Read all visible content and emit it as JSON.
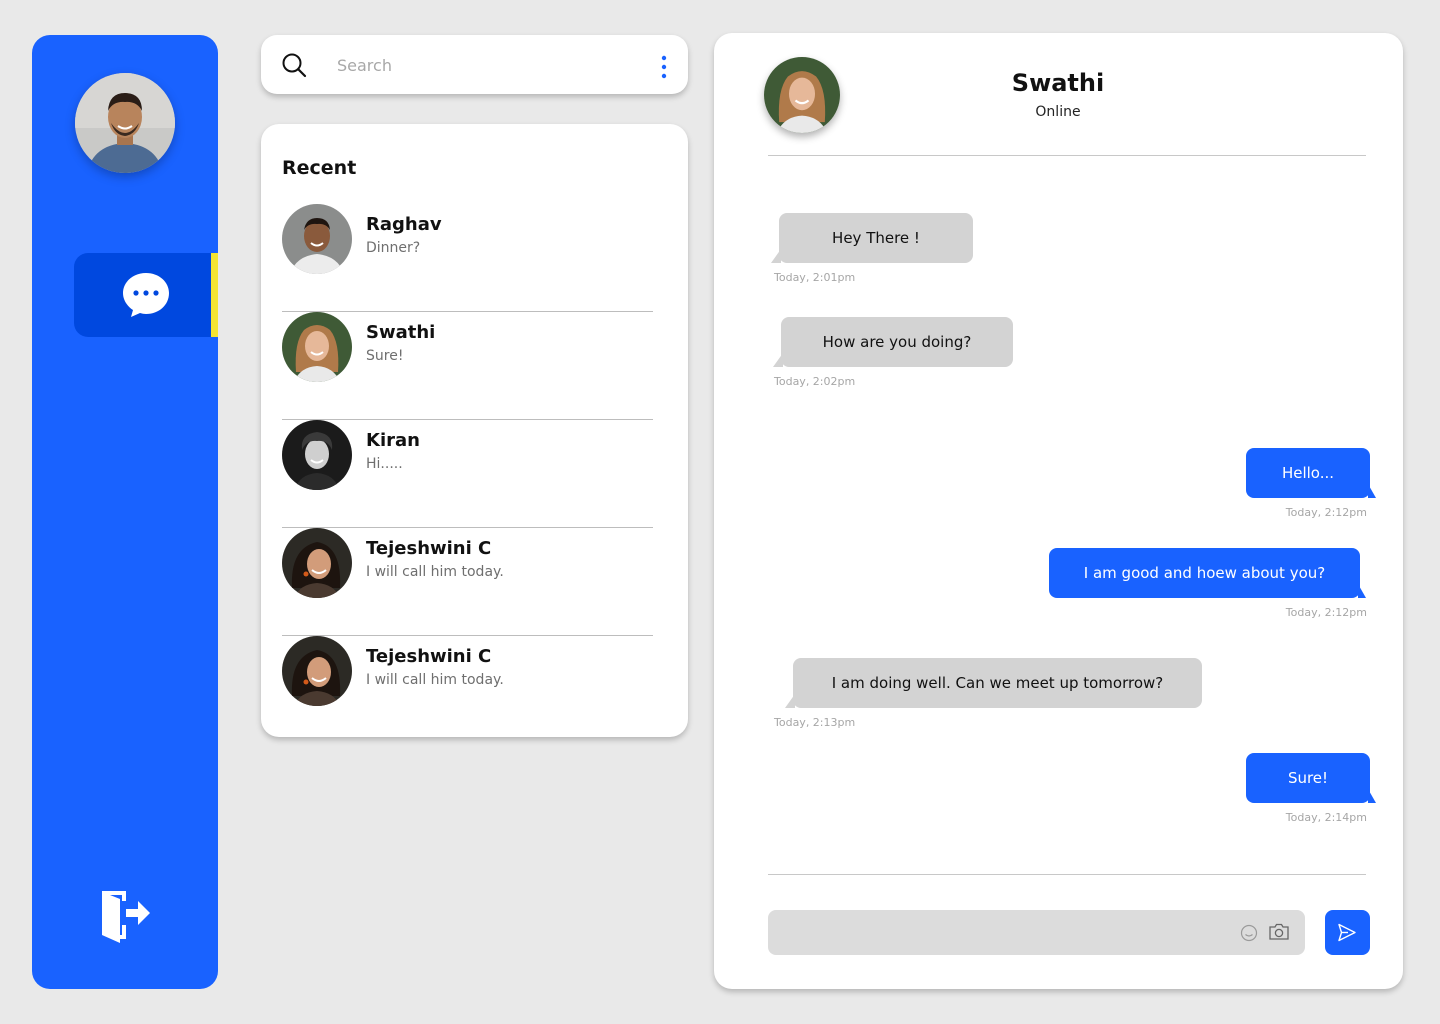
{
  "sidebar": {
    "user_avatar": "user-avatar",
    "nav": [
      {
        "name": "chat",
        "icon": "chat-bubble-icon",
        "active": true
      }
    ],
    "logout_icon": "logout-icon"
  },
  "search": {
    "placeholder": "Search",
    "menu_icon": "kebab-menu-icon"
  },
  "recent": {
    "title": "Recent",
    "contacts": [
      {
        "name": "Raghav",
        "last_message": "Dinner?"
      },
      {
        "name": "Swathi",
        "last_message": "Sure!"
      },
      {
        "name": "Kiran",
        "last_message": "Hi....."
      },
      {
        "name": "Tejeshwini C",
        "last_message": "I will call him today."
      },
      {
        "name": "Tejeshwini C",
        "last_message": "I will call him today."
      }
    ]
  },
  "chat": {
    "contact_name": "Swathi",
    "status": "Online",
    "messages": [
      {
        "direction": "in",
        "text": "Hey There !",
        "time": "Today, 2:01pm"
      },
      {
        "direction": "in",
        "text": "How are you doing?",
        "time": "Today, 2:02pm"
      },
      {
        "direction": "out",
        "text": "Hello...",
        "time": "Today, 2:12pm"
      },
      {
        "direction": "out",
        "text": "I am good  and hoew about you?",
        "time": "Today, 2:12pm"
      },
      {
        "direction": "in",
        "text": "I am doing well. Can we meet up tomorrow?",
        "time": "Today, 2:13pm"
      },
      {
        "direction": "out",
        "text": "Sure!",
        "time": "Today, 2:14pm"
      }
    ],
    "composer": {
      "placeholder": "",
      "emoji_icon": "emoji-icon",
      "camera_icon": "camera-icon"
    },
    "send_icon": "send-icon"
  },
  "colors": {
    "primary": "#1962ff",
    "primary_dark": "#0048df",
    "active_indicator": "#f4e433",
    "incoming_bubble": "#d3d3d3",
    "background": "#e9e9e9"
  }
}
